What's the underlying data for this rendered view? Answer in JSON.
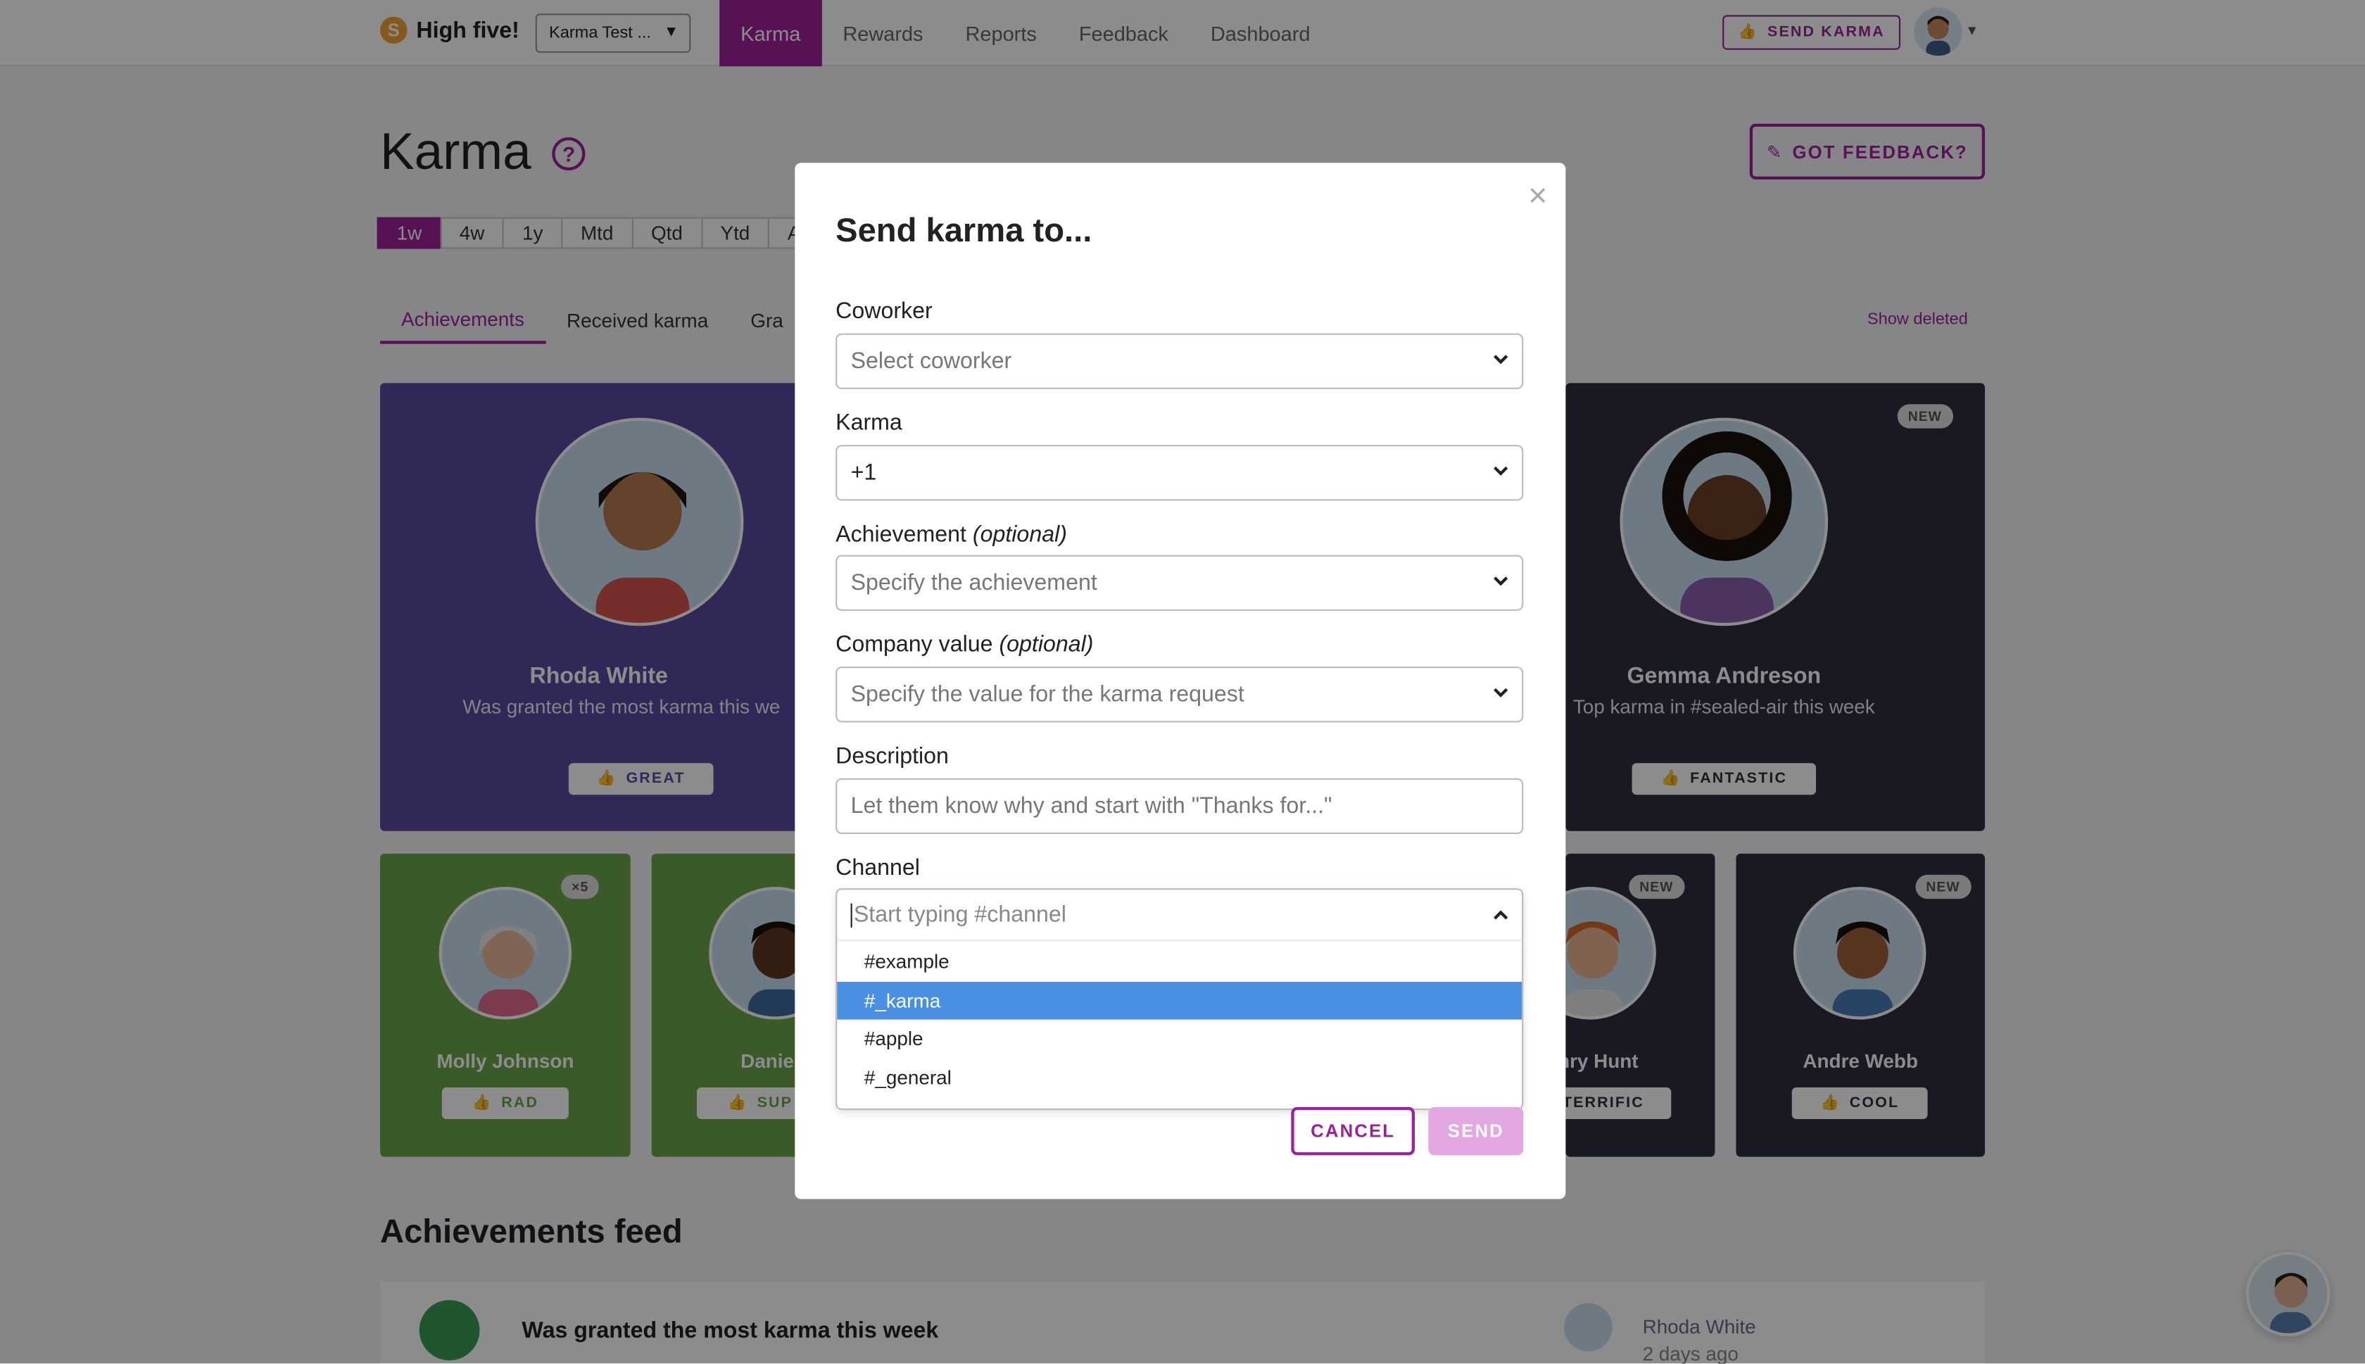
{
  "nav": {
    "brand": "High five!",
    "brand_logo": "S",
    "team": "Karma Test ...",
    "links": [
      "Karma",
      "Rewards",
      "Reports",
      "Feedback",
      "Dashboard"
    ],
    "send_karma": "SEND KARMA"
  },
  "page": {
    "title": "Karma",
    "got_feedback": "GOT FEEDBACK?",
    "periods": [
      "1w",
      "4w",
      "1y",
      "Mtd",
      "Qtd",
      "Ytd",
      "A"
    ],
    "tabs": [
      "Achievements",
      "Received karma",
      "Gra"
    ],
    "show_deleted": "Show deleted"
  },
  "cards": {
    "big": [
      {
        "name": "Rhoda White",
        "sub": "Was granted the most karma this we",
        "badge": "GREAT",
        "color": "#5b4aa0"
      },
      {
        "name": "Gemma Andreson",
        "sub": "Top karma in #sealed-air this week",
        "badge": "FANTASTIC",
        "tag": "NEW",
        "color": "#2d2f3f"
      }
    ],
    "small": [
      {
        "name": "Molly Johnson",
        "badge": "RAD",
        "tag": "×5",
        "color": "#6aa54a"
      },
      {
        "name": "Daniel C",
        "badge": "SUP",
        "color": "#6aa54a"
      },
      {
        "name": "nry Hunt",
        "badge": "TERRIFIC",
        "tag": "NEW",
        "color": "#2d2f3f"
      },
      {
        "name": "Andre Webb",
        "badge": "COOL",
        "tag": "NEW",
        "color": "#2d2f3f"
      }
    ]
  },
  "feed": {
    "title": "Achievements feed",
    "text": "Was granted the most karma this week",
    "user": "Rhoda White",
    "time": "2 days ago"
  },
  "modal": {
    "title": "Send karma to...",
    "coworker_label": "Coworker",
    "coworker_placeholder": "Select coworker",
    "karma_label": "Karma",
    "karma_value": "+1",
    "achievement_label": "Achievement",
    "achievement_optional": "(optional)",
    "achievement_placeholder": "Specify the achievement",
    "value_label": "Company value",
    "value_optional": "(optional)",
    "value_placeholder": "Specify the value for the karma request",
    "description_label": "Description",
    "description_placeholder": "Let them know why and start with \"Thanks for...\"",
    "channel_label": "Channel",
    "channel_placeholder": "Start typing #channel",
    "channel_options": [
      "#example",
      "#_karma",
      "#apple",
      "#_general"
    ],
    "cancel": "CANCEL",
    "send": "SEND"
  },
  "colors": {
    "accent": "#9e1f9b",
    "highlight": "#4a90e2"
  }
}
